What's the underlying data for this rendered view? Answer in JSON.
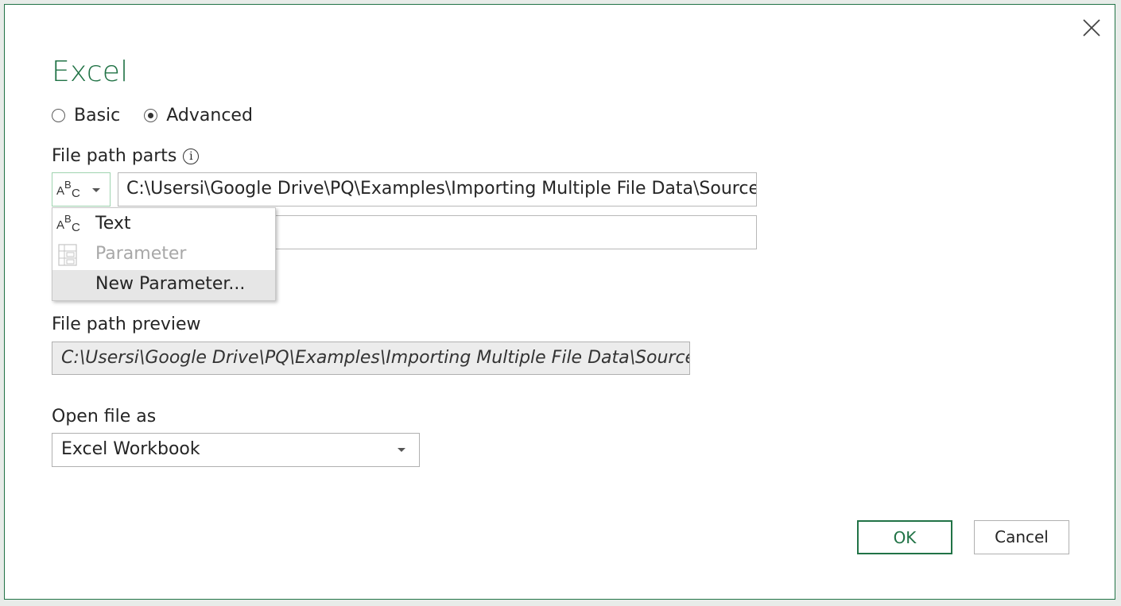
{
  "dialog": {
    "title": "Excel",
    "close_icon": "close-icon"
  },
  "mode": {
    "options": [
      {
        "label": "Basic",
        "checked": false
      },
      {
        "label": "Advanced",
        "checked": true
      }
    ]
  },
  "file_path_parts": {
    "label": "File path parts",
    "info_icon": "i",
    "type_button_icon": "abc-icon",
    "part1_value": "C:\\Usersi\\Google Drive\\PQ\\Examples\\Importing Multiple File Data\\Source Files",
    "part2_value": ""
  },
  "type_menu": {
    "items": [
      {
        "label": "Text",
        "icon": "abc-icon",
        "enabled": true
      },
      {
        "label": "Parameter",
        "icon": "parameter-icon",
        "enabled": false
      },
      {
        "label": "New Parameter...",
        "icon": "",
        "enabled": true,
        "highlighted": true
      }
    ]
  },
  "file_path_preview": {
    "label": "File path preview",
    "value": "C:\\Usersi\\Google Drive\\PQ\\Examples\\Importing Multiple File Data\\Source Files"
  },
  "open_file_as": {
    "label": "Open file as",
    "selected": "Excel Workbook"
  },
  "buttons": {
    "ok": "OK",
    "cancel": "Cancel"
  },
  "colors": {
    "accent": "#217346"
  }
}
